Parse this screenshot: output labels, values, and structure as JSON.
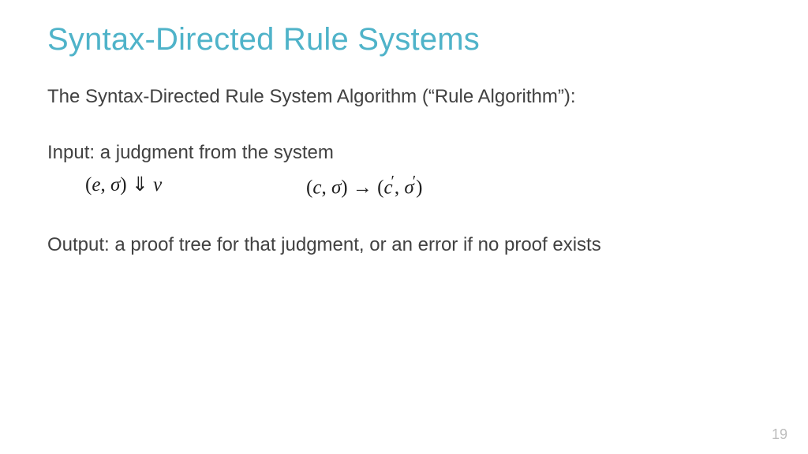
{
  "title": "Syntax-Directed Rule Systems",
  "intro": "The Syntax-Directed Rule System Algorithm (“Rule Algorithm”):",
  "input_line": "Input: a judgment from the system",
  "formula1": {
    "lparen": "(",
    "e": "e",
    "comma": ", ",
    "sigma": "σ",
    "rparen": ")",
    "arrow": " ⇓ ",
    "v": "v"
  },
  "formula2": {
    "lparen1": "(",
    "c1": "c",
    "comma1": ", ",
    "sigma1": "σ",
    "rparen1": ")",
    "arrow": " → ",
    "lparen2": "(",
    "c2": "c",
    "prime1": "′",
    "comma2": ", ",
    "sigma2": "σ",
    "prime2": "′",
    "rparen2": ")"
  },
  "output_line": "Output: a proof tree for that judgment, or an error if no proof exists",
  "page_number": "19"
}
